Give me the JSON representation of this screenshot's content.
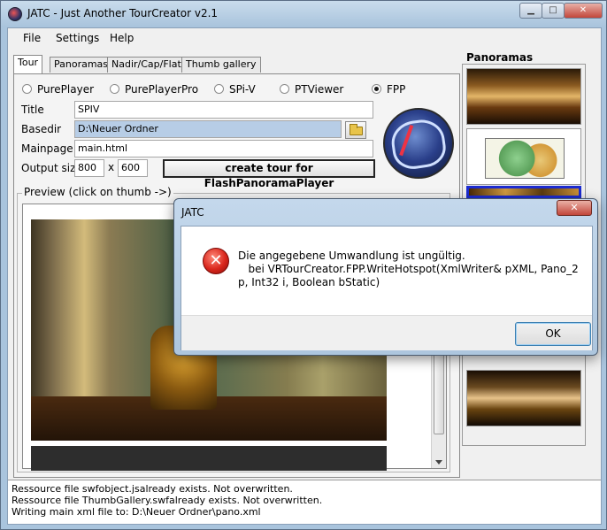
{
  "window": {
    "title": "JATC - Just Another TourCreator v2.1",
    "min_glyph": "▁",
    "max_glyph": "□",
    "close_glyph": "✕"
  },
  "menu": [
    "File",
    "Settings",
    "Help"
  ],
  "tabs": [
    "Tour",
    "Panoramas",
    "Nadir/Cap/Flat",
    "Thumb gallery"
  ],
  "active_tab": "Tour",
  "players": [
    "PurePlayer",
    "PurePlayerPro",
    "SPi-V",
    "PTViewer",
    "FPP"
  ],
  "selected_player": "FPP",
  "form": {
    "title_label": "Title",
    "title_value": "SPIV",
    "basedir_label": "Basedir",
    "basedir_value": "D:\\Neuer Ordner",
    "mainpage_label": "Mainpage",
    "mainpage_value": "main.html",
    "output_label": "Output size",
    "width": "800",
    "x_sep": "x",
    "height": "600",
    "create_button": "create tour for FlashPanoramaPlayer"
  },
  "preview": {
    "legend": "Preview  (click on thumb ->)"
  },
  "log": [
    "Ressource file swfobject.jsalready exists. Not overwritten.",
    "Ressource file ThumbGallery.swfalready exists. Not overwritten.",
    "Writing main xml file to: D:\\Neuer Ordner\\pano.xml"
  ],
  "panoramas": {
    "title": "Panoramas"
  },
  "dialog": {
    "title": "JATC",
    "close_glyph": "✕",
    "icon_glyph": "✕",
    "message": "Die angegebene Umwandlung ist ungültig.\n   bei VRTourCreator.FPP.WriteHotspot(XmlWriter& pXML, Pano_2 p, Int32 i, Boolean bStatic)",
    "ok": "OK"
  },
  "colors": {
    "selection_border": "#1b2bd1",
    "error_red": "#d9261c"
  }
}
